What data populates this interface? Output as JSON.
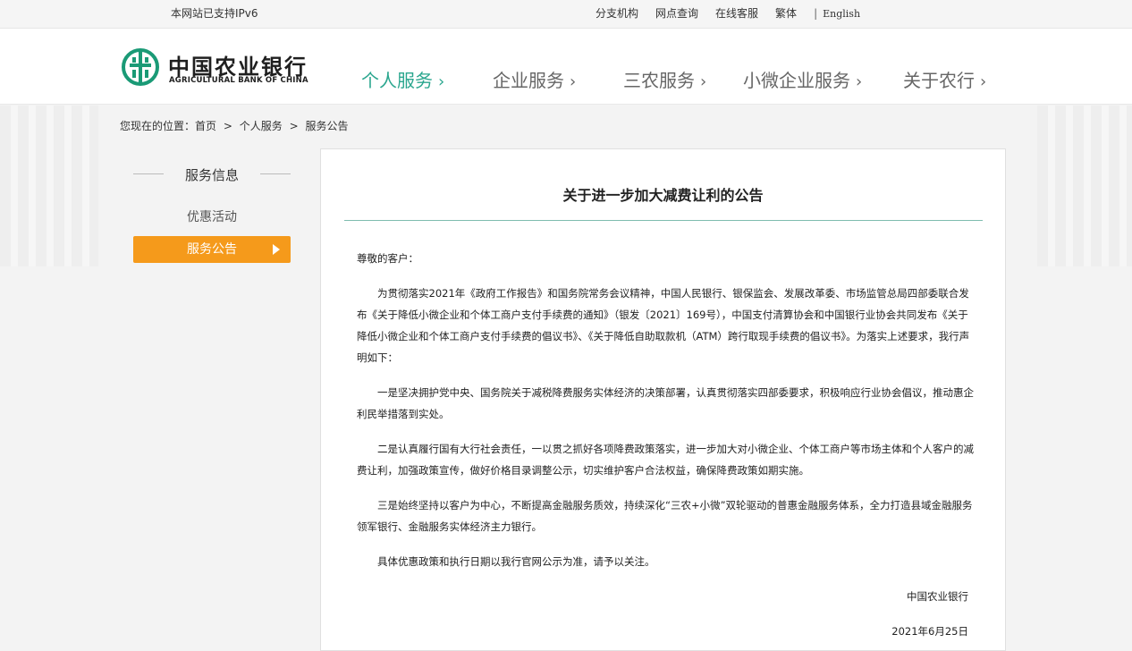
{
  "topbar": {
    "ipv6_notice": "本网站已支持IPv6",
    "links": [
      "分支机构",
      "网点查询",
      "在线客服",
      "繁体"
    ],
    "separator": "|",
    "english": "English"
  },
  "header": {
    "logo_cn": "中国农业银行",
    "logo_en": "AGRICULTURAL BANK OF CHINA",
    "nav": [
      {
        "label": "个人服务",
        "chevron": "›"
      },
      {
        "label": "企业服务",
        "chevron": "›"
      },
      {
        "label": "三农服务",
        "chevron": "›"
      },
      {
        "label": "小微企业服务",
        "chevron": "›"
      },
      {
        "label": "关于农行",
        "chevron": "›"
      }
    ],
    "active_nav": 0
  },
  "breadcrumb": {
    "prefix": "您现在的位置：",
    "items": [
      "首页",
      "个人服务",
      "服务公告"
    ],
    "separator": ">"
  },
  "sidebar": {
    "title": "服务信息",
    "items": [
      "优惠活动",
      "服务公告"
    ],
    "active_item": 1
  },
  "article": {
    "title": "关于进一步加大减费让利的公告",
    "greeting": "尊敬的客户：",
    "paragraphs": [
      "为贯彻落实2021年《政府工作报告》和国务院常务会议精神，中国人民银行、银保监会、发展改革委、市场监管总局四部委联合发布《关于降低小微企业和个体工商户支付手续费的通知》（银发〔2021〕169号），中国支付清算协会和中国银行业协会共同发布《关于降低小微企业和个体工商户支付手续费的倡议书》、《关于降低自助取款机（ATM）跨行取现手续费的倡议书》。为落实上述要求，我行声明如下：",
      "一是坚决拥护党中央、国务院关于减税降费服务实体经济的决策部署，认真贯彻落实四部委要求，积极响应行业协会倡议，推动惠企利民举措落到实处。",
      "二是认真履行国有大行社会责任，一以贯之抓好各项降费政策落实，进一步加大对小微企业、个体工商户等市场主体和个人客户的减费让利，加强政策宣传，做好价格目录调整公示，切实维护客户合法权益，确保降费政策如期实施。",
      "三是始终坚持以客户为中心，不断提高金融服务质效，持续深化“三农+小微”双轮驱动的普惠金融服务体系，全力打造县域金融服务领军银行、金融服务实体经济主力银行。",
      "具体优惠政策和执行日期以我行官网公示为准，请予以关注。"
    ],
    "signature": "中国农业银行",
    "date": "2021年6月25日"
  },
  "colors": {
    "accent_green": "#2aa68e",
    "accent_orange": "#f59a1b",
    "rule_teal": "#7fbcaf"
  }
}
